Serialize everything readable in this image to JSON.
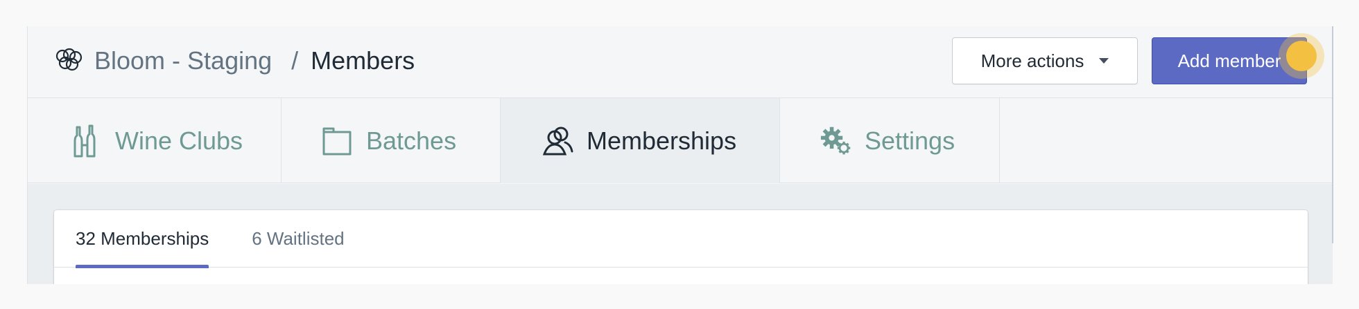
{
  "header": {
    "app_name": "Bloom - Staging",
    "separator": "/",
    "page_title": "Members",
    "more_actions_label": "More actions",
    "add_member_label": "Add member"
  },
  "nav_tabs": [
    {
      "label": "Wine Clubs",
      "icon": "wine-bottles-icon",
      "active": false
    },
    {
      "label": "Batches",
      "icon": "box-icon",
      "active": false
    },
    {
      "label": "Memberships",
      "icon": "users-icon",
      "active": true
    },
    {
      "label": "Settings",
      "icon": "gears-icon",
      "active": false
    }
  ],
  "sub_tabs": [
    {
      "label": "32 Memberships",
      "active": true
    },
    {
      "label": "6 Waitlisted",
      "active": false
    }
  ],
  "colors": {
    "accent": "#5c6ac4",
    "nav_inactive_text": "#6e9a93",
    "cursor_highlight": "#f4c041"
  }
}
